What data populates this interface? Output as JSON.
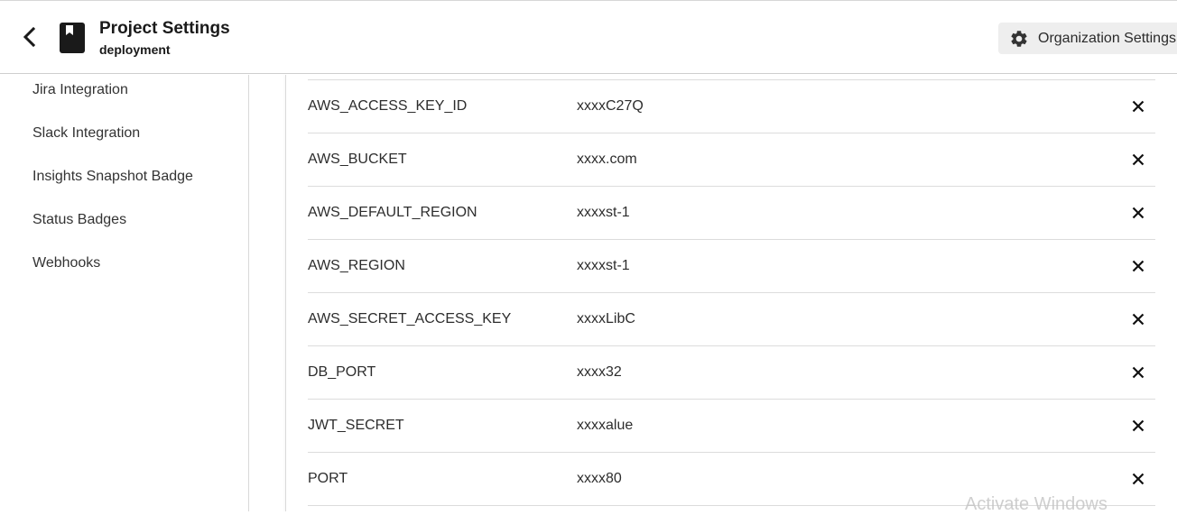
{
  "header": {
    "title": "Project Settings",
    "subtitle": "deployment",
    "org_settings_label": "Organization Settings",
    "icons": {
      "back": "chevron-left-icon",
      "project": "bookmark-book-icon",
      "org": "gear-icon"
    }
  },
  "sidebar": {
    "items": [
      {
        "label": "Jira Integration"
      },
      {
        "label": "Slack Integration"
      },
      {
        "label": "Insights Snapshot Badge"
      },
      {
        "label": "Status Badges"
      },
      {
        "label": "Webhooks"
      }
    ]
  },
  "env_vars": {
    "rows": [
      {
        "name": "AWS_ACCESS_KEY_ID",
        "value": "xxxxC27Q"
      },
      {
        "name": "AWS_BUCKET",
        "value": "xxxx.com"
      },
      {
        "name": "AWS_DEFAULT_REGION",
        "value": "xxxxst-1"
      },
      {
        "name": "AWS_REGION",
        "value": "xxxxst-1"
      },
      {
        "name": "AWS_SECRET_ACCESS_KEY",
        "value": "xxxxLibC"
      },
      {
        "name": "DB_PORT",
        "value": "xxxx32"
      },
      {
        "name": "JWT_SECRET",
        "value": "xxxxalue"
      },
      {
        "name": "PORT",
        "value": "xxxx80"
      }
    ],
    "delete_icon": "close-icon"
  },
  "watermark": "Activate Windows",
  "colors": {
    "text": "#1f1f1f",
    "divider": "#dcdcdc",
    "button_bg": "#eeeeee"
  }
}
